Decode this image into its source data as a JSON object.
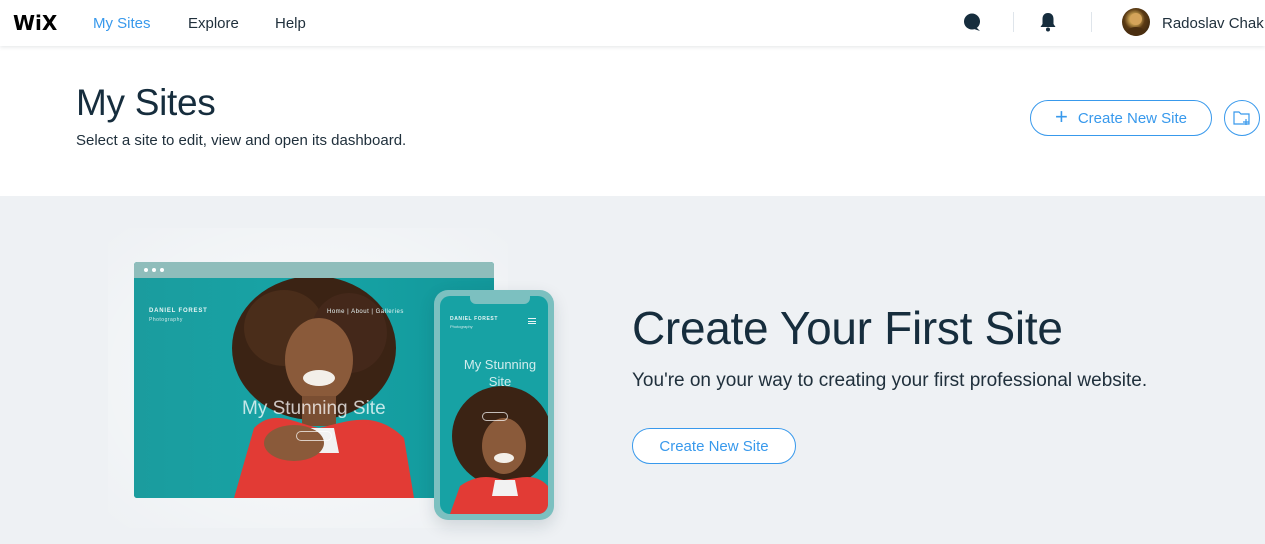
{
  "topbar": {
    "logo": "WiX",
    "nav": [
      {
        "label": "My Sites",
        "active": true
      },
      {
        "label": "Explore",
        "active": false
      },
      {
        "label": "Help",
        "active": false
      }
    ],
    "user_name": "Radoslav Chak",
    "icons": [
      "chat-icon",
      "bell-icon",
      "avatar"
    ]
  },
  "header": {
    "title": "My Sites",
    "subtitle": "Select a site to edit, view and open its dashboard.",
    "create_button": "Create New Site",
    "folder_button_icon": "add-folder-icon"
  },
  "empty_state": {
    "title": "Create Your First Site",
    "subtitle": "You're on your way to creating your first professional website.",
    "create_button": "Create New Site",
    "mock_desktop": {
      "brand": "DANIEL FOREST",
      "brand_sub": "Photography",
      "menu": "Home  |  About  |  Galleries",
      "hero_text": "My Stunning Site"
    },
    "mock_phone": {
      "brand": "DANIEL FOREST",
      "brand_sub": "Photography",
      "hero_text": "My Stunning Site"
    }
  },
  "colors": {
    "accent": "#3899ec",
    "text_dark": "#162d3d",
    "panel_bg": "#eef1f4",
    "teal": "#1aa3a3"
  }
}
